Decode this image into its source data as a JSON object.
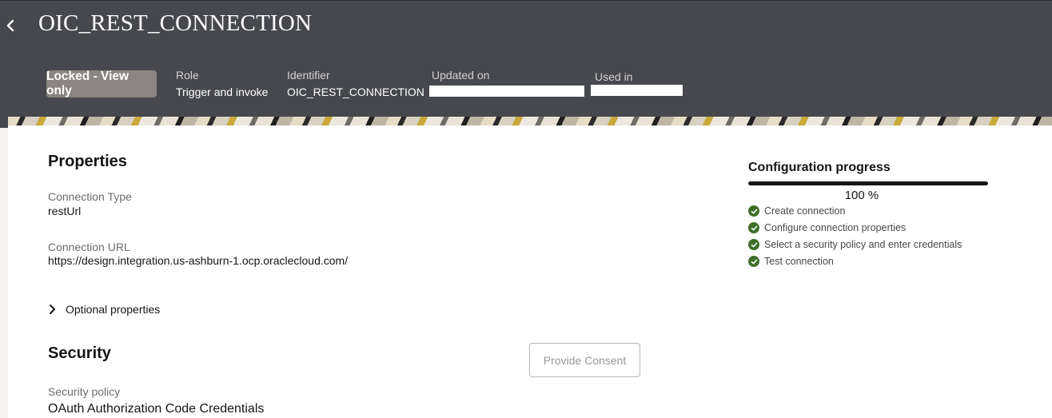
{
  "header": {
    "title": "OIC_REST_CONNECTION",
    "back_icon": "chevron-left-icon",
    "lock_badge": "Locked - View only",
    "meta": [
      {
        "label": "Role",
        "value": "Trigger and invoke"
      },
      {
        "label": "Identifier",
        "value": "OIC_REST_CONNECTION"
      },
      {
        "label": "Updated on",
        "value": ""
      },
      {
        "label": "Used in",
        "value": ""
      }
    ]
  },
  "properties": {
    "title": "Properties",
    "connection_type": {
      "label": "Connection Type",
      "value": "restUrl"
    },
    "connection_url": {
      "label": "Connection URL",
      "value": "https://design.integration.us-ashburn-1.ocp.oraclecloud.com/"
    },
    "optional_label": "Optional properties"
  },
  "security": {
    "title": "Security",
    "consent_button": "Provide Consent",
    "policy": {
      "label": "Security policy",
      "value": "OAuth Authorization Code Credentials"
    }
  },
  "progress": {
    "title": "Configuration progress",
    "percent": 100,
    "percent_label": "100 %",
    "steps": [
      {
        "label": "Create connection",
        "done": true
      },
      {
        "label": "Configure connection properties",
        "done": true
      },
      {
        "label": "Select a security policy and enter credentials",
        "done": true
      },
      {
        "label": "Test connection",
        "done": true
      }
    ],
    "check_color": "#3e6e2a"
  },
  "colors": {
    "header_bg": "#46484d",
    "badge_bg": "#8a8580"
  }
}
